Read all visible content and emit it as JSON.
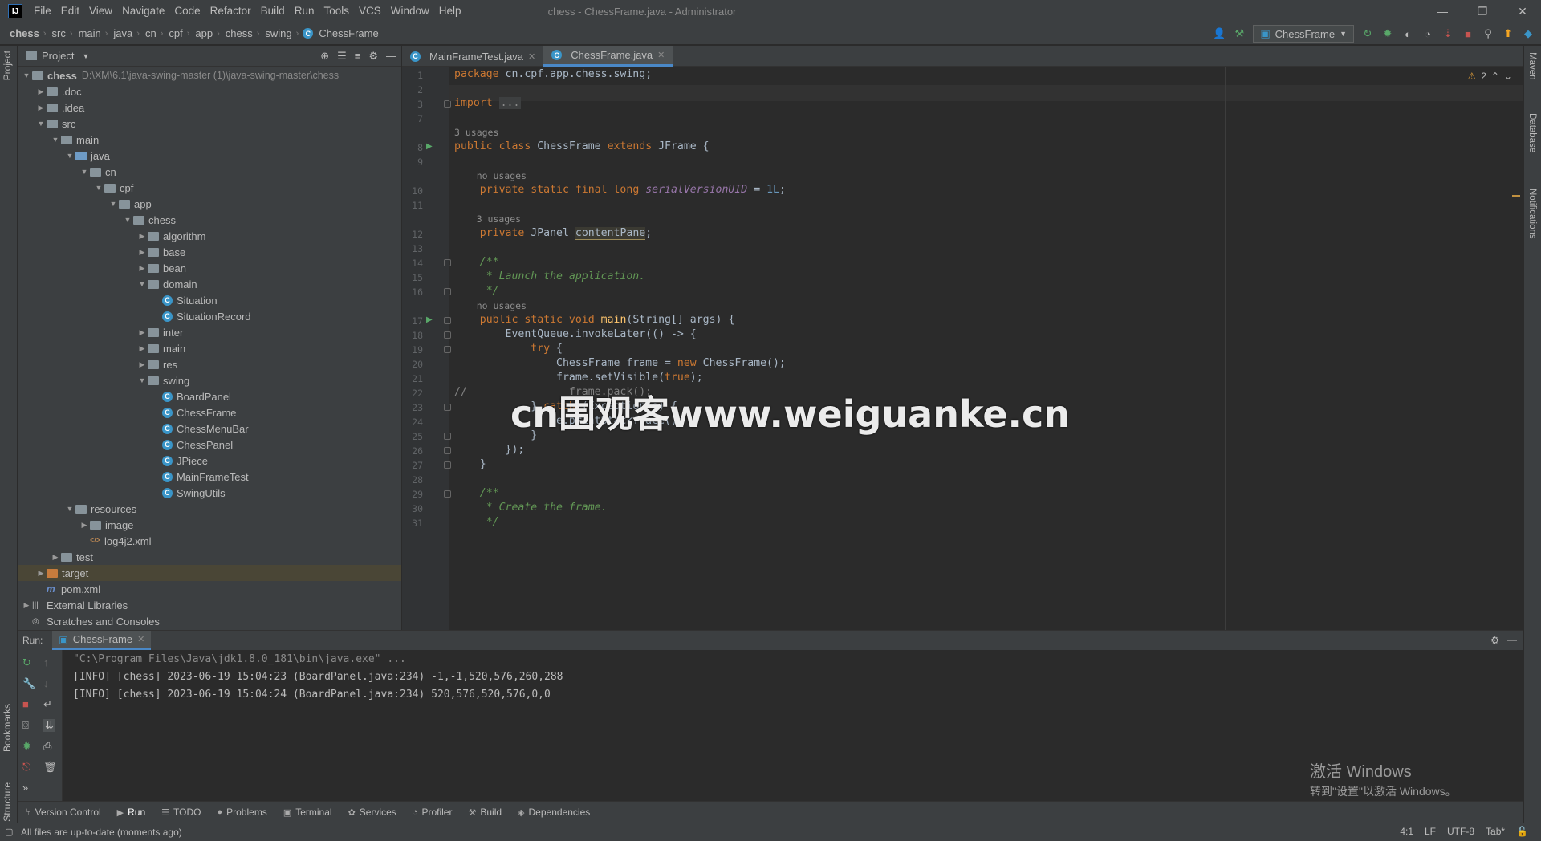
{
  "app": {
    "logo_text": "IJ",
    "window_title": "chess - ChessFrame.java - Administrator"
  },
  "menu": [
    "File",
    "Edit",
    "View",
    "Navigate",
    "Code",
    "Refactor",
    "Build",
    "Run",
    "Tools",
    "VCS",
    "Window",
    "Help"
  ],
  "breadcrumbs": [
    "chess",
    "src",
    "main",
    "java",
    "cn",
    "cpf",
    "app",
    "chess",
    "swing",
    "ChessFrame"
  ],
  "toolbar": {
    "run_config": "ChessFrame"
  },
  "left_stripe": {
    "project": "Project",
    "bookmarks": "Bookmarks",
    "structure": "Structure"
  },
  "right_stripe": {
    "maven": "Maven",
    "database": "Database",
    "notifications": "Notifications"
  },
  "project_panel": {
    "title": "Project",
    "root_path": "D:\\XM\\6.1\\java-swing-master (1)\\java-swing-master\\chess",
    "tree": [
      {
        "label": "chess",
        "depth": 0,
        "arrow": "open",
        "icon": "folder",
        "bold": true
      },
      {
        "label": ".doc",
        "depth": 1,
        "arrow": "closed",
        "icon": "folder"
      },
      {
        "label": ".idea",
        "depth": 1,
        "arrow": "closed",
        "icon": "folder"
      },
      {
        "label": "src",
        "depth": 1,
        "arrow": "open",
        "icon": "folder"
      },
      {
        "label": "main",
        "depth": 2,
        "arrow": "open",
        "icon": "folder"
      },
      {
        "label": "java",
        "depth": 3,
        "arrow": "open",
        "icon": "folder-blue"
      },
      {
        "label": "cn",
        "depth": 4,
        "arrow": "open",
        "icon": "folder"
      },
      {
        "label": "cpf",
        "depth": 5,
        "arrow": "open",
        "icon": "folder"
      },
      {
        "label": "app",
        "depth": 6,
        "arrow": "open",
        "icon": "folder"
      },
      {
        "label": "chess",
        "depth": 7,
        "arrow": "open",
        "icon": "folder"
      },
      {
        "label": "algorithm",
        "depth": 8,
        "arrow": "closed",
        "icon": "folder"
      },
      {
        "label": "base",
        "depth": 8,
        "arrow": "closed",
        "icon": "folder"
      },
      {
        "label": "bean",
        "depth": 8,
        "arrow": "closed",
        "icon": "folder"
      },
      {
        "label": "domain",
        "depth": 8,
        "arrow": "open",
        "icon": "folder"
      },
      {
        "label": "Situation",
        "depth": 9,
        "arrow": "none",
        "icon": "class"
      },
      {
        "label": "SituationRecord",
        "depth": 9,
        "arrow": "none",
        "icon": "class"
      },
      {
        "label": "inter",
        "depth": 8,
        "arrow": "closed",
        "icon": "folder"
      },
      {
        "label": "main",
        "depth": 8,
        "arrow": "closed",
        "icon": "folder"
      },
      {
        "label": "res",
        "depth": 8,
        "arrow": "closed",
        "icon": "folder"
      },
      {
        "label": "swing",
        "depth": 8,
        "arrow": "open",
        "icon": "folder"
      },
      {
        "label": "BoardPanel",
        "depth": 9,
        "arrow": "none",
        "icon": "class"
      },
      {
        "label": "ChessFrame",
        "depth": 9,
        "arrow": "none",
        "icon": "class"
      },
      {
        "label": "ChessMenuBar",
        "depth": 9,
        "arrow": "none",
        "icon": "class"
      },
      {
        "label": "ChessPanel",
        "depth": 9,
        "arrow": "none",
        "icon": "class"
      },
      {
        "label": "JPiece",
        "depth": 9,
        "arrow": "none",
        "icon": "class"
      },
      {
        "label": "MainFrameTest",
        "depth": 9,
        "arrow": "none",
        "icon": "class"
      },
      {
        "label": "SwingUtils",
        "depth": 9,
        "arrow": "none",
        "icon": "class"
      },
      {
        "label": "resources",
        "depth": 3,
        "arrow": "open",
        "icon": "folder"
      },
      {
        "label": "image",
        "depth": 4,
        "arrow": "closed",
        "icon": "folder"
      },
      {
        "label": "log4j2.xml",
        "depth": 4,
        "arrow": "none",
        "icon": "xml"
      },
      {
        "label": "test",
        "depth": 2,
        "arrow": "closed",
        "icon": "folder"
      },
      {
        "label": "target",
        "depth": 1,
        "arrow": "closed",
        "icon": "folder-orange",
        "selected": true
      },
      {
        "label": "pom.xml",
        "depth": 1,
        "arrow": "none",
        "icon": "maven"
      },
      {
        "label": "External Libraries",
        "depth": 0,
        "arrow": "closed",
        "icon": "library"
      },
      {
        "label": "Scratches and Consoles",
        "depth": 0,
        "arrow": "none",
        "icon": "scratch"
      }
    ]
  },
  "editor": {
    "tabs": [
      {
        "label": "MainFrameTest.java",
        "active": false
      },
      {
        "label": "ChessFrame.java",
        "active": true
      }
    ],
    "warning_count": "2",
    "code_lines": [
      {
        "n": "1",
        "html": "<span class=\"kw\">package</span> cn.cpf.app.chess.swing;"
      },
      {
        "n": "2",
        "html": ""
      },
      {
        "n": "3",
        "html": "<span class=\"kw\">import</span> <span class=\"fold-ph\">...</span>",
        "fold": true
      },
      {
        "n": "7",
        "html": ""
      },
      {
        "usages": "3 usages"
      },
      {
        "n": "8",
        "html": "<span class=\"kw\">public class</span> ChessFrame <span class=\"kw\">extends</span> JFrame {",
        "run": true
      },
      {
        "n": "9",
        "html": ""
      },
      {
        "usages": "    no usages"
      },
      {
        "n": "10",
        "html": "    <span class=\"kw\">private static final long</span> <span class=\"fld\">serialVersionUID</span> = <span class=\"num\">1L</span>;"
      },
      {
        "n": "11",
        "html": ""
      },
      {
        "usages": "    3 usages"
      },
      {
        "n": "12",
        "html": "    <span class=\"kw\">private</span> JPanel <span class=\"hl\">contentPane</span>;"
      },
      {
        "n": "13",
        "html": ""
      },
      {
        "n": "14",
        "html": "    <span class=\"cm\">/**</span>",
        "fold": true
      },
      {
        "n": "15",
        "html": "<span class=\"cm\">     * Launch the application.</span>"
      },
      {
        "n": "16",
        "html": "<span class=\"cm\">     */</span>",
        "fold": true
      },
      {
        "usages": "    no usages"
      },
      {
        "n": "17",
        "html": "    <span class=\"kw\">public static void</span> <span class=\"fn\">main</span>(String[] args) {",
        "run": true,
        "fold": true
      },
      {
        "n": "18",
        "html": "        EventQueue.invokeLater(() -> {",
        "fold": true
      },
      {
        "n": "19",
        "html": "            <span class=\"kw\">try</span> {",
        "fold": true
      },
      {
        "n": "20",
        "html": "                ChessFrame frame = <span class=\"kw\">new</span> ChessFrame();"
      },
      {
        "n": "21",
        "html": "                frame.setVisible(<span class=\"kw\">true</span>);"
      },
      {
        "n": "22",
        "html": "<span class=\"cm\" style=\"font-style:normal;color:#808080\">//                frame.pack();</span>"
      },
      {
        "n": "23",
        "html": "            } <span class=\"kw\">catch</span> (Exception e) {",
        "fold": true
      },
      {
        "n": "24",
        "html": "                e.printStackTrace();"
      },
      {
        "n": "25",
        "html": "            }",
        "fold": true
      },
      {
        "n": "26",
        "html": "        });",
        "fold": true
      },
      {
        "n": "27",
        "html": "    }",
        "fold": true
      },
      {
        "n": "28",
        "html": ""
      },
      {
        "n": "29",
        "html": "    <span class=\"cm\">/**</span>",
        "fold": true
      },
      {
        "n": "30",
        "html": "<span class=\"cm\">     * Create the frame.</span>"
      },
      {
        "n": "31",
        "html": "<span class=\"cm\">     */</span>"
      }
    ]
  },
  "watermark": "cn围观客www.weiguanke.cn",
  "run_panel": {
    "label": "Run:",
    "tab": "ChessFrame",
    "lines": [
      "\"C:\\Program Files\\Java\\jdk1.8.0_181\\bin\\java.exe\" ...",
      "[INFO] [chess] 2023-06-19 15:04:23 (BoardPanel.java:234) -1,-1,520,576,260,288",
      "[INFO] [chess] 2023-06-19 15:04:24 (BoardPanel.java:234) 520,576,520,576,0,0"
    ]
  },
  "activation": {
    "line1": "激活 Windows",
    "line2": "转到\"设置\"以激活 Windows。"
  },
  "bottom_tabs": [
    {
      "label": "Version Control",
      "icon": "⑂"
    },
    {
      "label": "Run",
      "icon": "▶",
      "active": true
    },
    {
      "label": "TODO",
      "icon": "☰"
    },
    {
      "label": "Problems",
      "icon": "●"
    },
    {
      "label": "Terminal",
      "icon": "▣"
    },
    {
      "label": "Services",
      "icon": "✿"
    },
    {
      "label": "Profiler",
      "icon": "◔"
    },
    {
      "label": "Build",
      "icon": "⚒"
    },
    {
      "label": "Dependencies",
      "icon": "◈"
    }
  ],
  "status": {
    "message": "All files are up-to-date (moments ago)",
    "position": "4:1",
    "line_sep": "LF",
    "encoding": "UTF-8",
    "indent": "Tab*"
  },
  "colors": {
    "accent": "#4a88c7",
    "run_green": "#59a869",
    "stop_red": "#c75450",
    "keyword": "#cc7832"
  }
}
